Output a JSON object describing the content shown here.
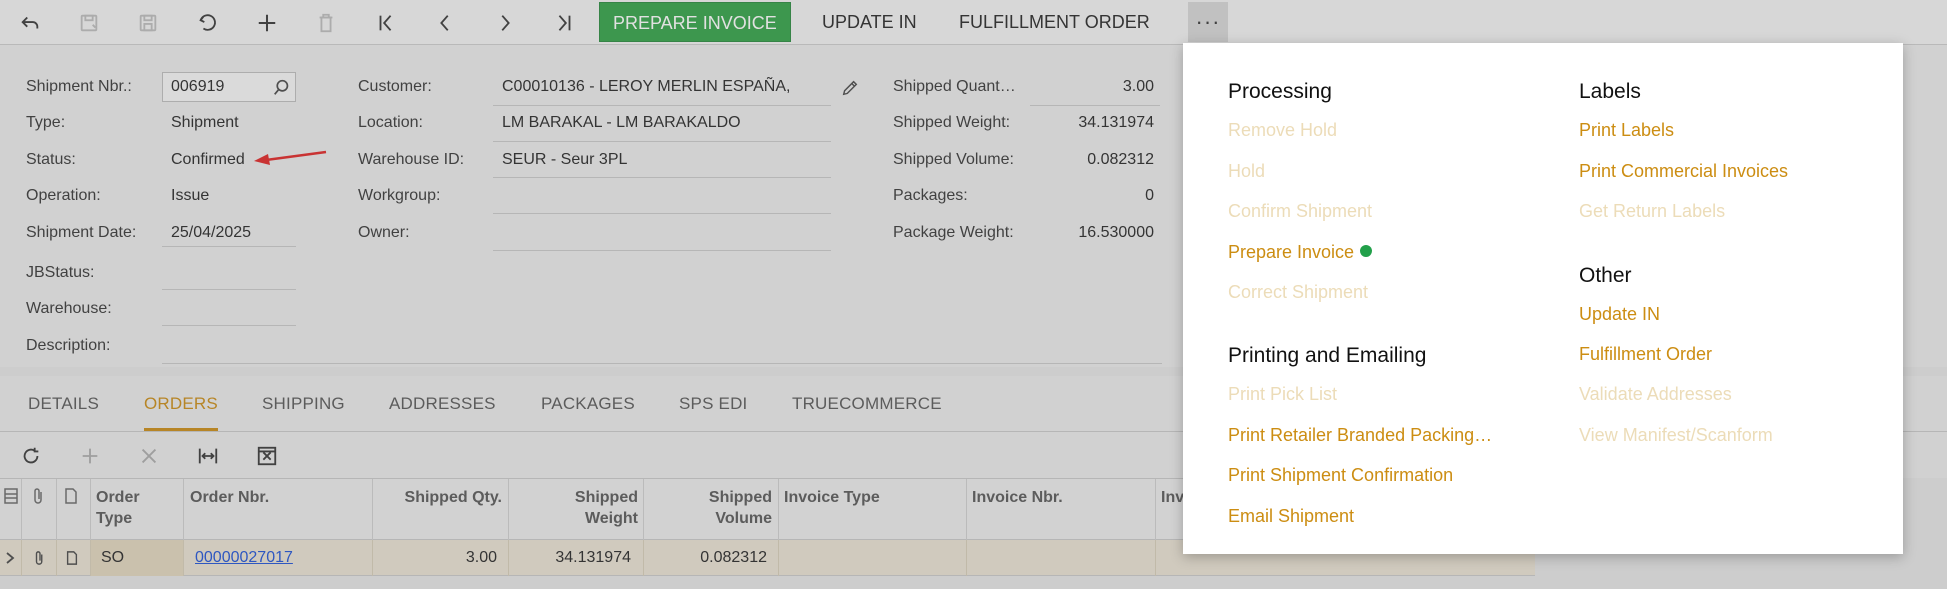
{
  "toolbar": {
    "icons": [
      "undo-back-icon",
      "save-close-icon",
      "save-icon",
      "cancel-icon",
      "add-icon",
      "delete-icon",
      "first-record-icon",
      "previous-record-icon",
      "next-record-icon",
      "last-record-icon"
    ],
    "prepare_invoice": "PREPARE INVOICE",
    "update_in": "UPDATE IN",
    "fulfillment_order": "FULFILLMENT ORDER",
    "more": "···"
  },
  "form": {
    "shipment_nbr_label": "Shipment Nbr.:",
    "shipment_nbr": "006919",
    "type_label": "Type:",
    "type": "Shipment",
    "status_label": "Status:",
    "status": "Confirmed",
    "operation_label": "Operation:",
    "operation": "Issue",
    "shipment_date_label": "Shipment Date:",
    "shipment_date": "25/04/2025",
    "jbstatus_label": "JBStatus:",
    "jbstatus": "",
    "warehouse_label": "Warehouse:",
    "warehouse": "",
    "description_label": "Description:",
    "description": "",
    "customer_label": "Customer:",
    "customer": "C00010136 - LEROY MERLIN ESPAÑA,",
    "location_label": "Location:",
    "location": "LM BARAKAL - LM BARAKALDO",
    "warehouse_id_label": "Warehouse ID:",
    "warehouse_id": "SEUR - Seur 3PL",
    "workgroup_label": "Workgroup:",
    "workgroup": "",
    "owner_label": "Owner:",
    "owner": "",
    "shipped_quantity_label": "Shipped Quant…",
    "shipped_quantity": "3.00",
    "shipped_weight_label": "Shipped Weight:",
    "shipped_weight": "34.131974",
    "shipped_volume_label": "Shipped Volume:",
    "shipped_volume": "0.082312",
    "packages_label": "Packages:",
    "packages": "0",
    "package_weight_label": "Package Weight:",
    "package_weight": "16.530000"
  },
  "tabs": [
    "DETAILS",
    "ORDERS",
    "SHIPPING",
    "ADDRESSES",
    "PACKAGES",
    "SPS EDI",
    "TRUECOMMERCE"
  ],
  "active_tab": "ORDERS",
  "grid": {
    "toolbar_icons": [
      "refresh-icon",
      "add-row-icon",
      "delete-row-icon",
      "fit-columns-icon",
      "export-excel-icon"
    ],
    "columns": [
      "Order Type",
      "Order Nbr.",
      "Shipped Qty.",
      "Shipped Weight",
      "Shipped Volume",
      "Invoice Type",
      "Invoice Nbr.",
      "Inv"
    ],
    "rows": [
      {
        "order_type": "SO",
        "order_nbr": "00000027017",
        "shipped_qty": "3.00",
        "shipped_weight": "34.131974",
        "shipped_volume": "0.082312",
        "invoice_type": "",
        "invoice_nbr": ""
      }
    ]
  },
  "menu": {
    "processing": {
      "title": "Processing",
      "items": [
        {
          "label": "Remove Hold",
          "enabled": false
        },
        {
          "label": "Hold",
          "enabled": false
        },
        {
          "label": "Confirm Shipment",
          "enabled": false
        },
        {
          "label": "Prepare Invoice",
          "enabled": true
        },
        {
          "label": "Correct Shipment",
          "enabled": false
        }
      ]
    },
    "printing": {
      "title": "Printing and Emailing",
      "items": [
        {
          "label": "Print Pick List",
          "enabled": false
        },
        {
          "label": "Print Retailer Branded Packing…",
          "enabled": true
        },
        {
          "label": "Print Shipment Confirmation",
          "enabled": true
        },
        {
          "label": "Email Shipment",
          "enabled": true
        }
      ]
    },
    "labels": {
      "title": "Labels",
      "items": [
        {
          "label": "Print Labels",
          "enabled": true
        },
        {
          "label": "Print Commercial Invoices",
          "enabled": true
        },
        {
          "label": "Get Return Labels",
          "enabled": false
        }
      ]
    },
    "other": {
      "title": "Other",
      "items": [
        {
          "label": "Update IN",
          "enabled": true
        },
        {
          "label": "Fulfillment Order",
          "enabled": true
        },
        {
          "label": "Validate Addresses",
          "enabled": false
        },
        {
          "label": "View Manifest/Scanform",
          "enabled": false
        }
      ]
    }
  },
  "colors": {
    "primary_green": "#2ea043",
    "accent_orange": "#cc8d12",
    "disabled_orange": "#ecdcb8",
    "link_blue": "#1a4fd6",
    "annotation_red": "#e02020"
  }
}
